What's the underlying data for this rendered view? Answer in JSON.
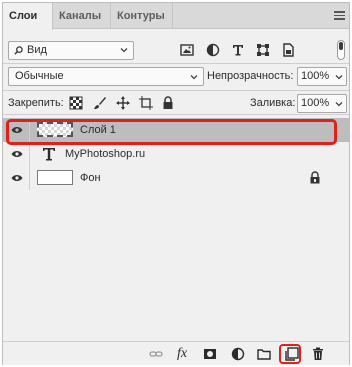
{
  "tabs": [
    {
      "label": "Слои",
      "active": true
    },
    {
      "label": "Каналы",
      "active": false
    },
    {
      "label": "Контуры",
      "active": false
    }
  ],
  "filter": {
    "kind_label": "Вид",
    "icons": [
      "pixel-filter-icon",
      "adjustment-filter-icon",
      "type-filter-icon",
      "shape-filter-icon",
      "smart-object-filter-icon"
    ]
  },
  "blend": {
    "mode": "Обычные",
    "opacity_label": "Непрозрачность:",
    "opacity_value": "100%"
  },
  "lock": {
    "label": "Закрепить:",
    "fill_label": "Заливка:",
    "fill_value": "100%"
  },
  "layers": [
    {
      "name": "Слой 1",
      "visible": true,
      "selected": true,
      "kind": "pixel"
    },
    {
      "name": "MyPhotoshop.ru",
      "visible": true,
      "selected": false,
      "kind": "text"
    },
    {
      "name": "Фон",
      "visible": true,
      "selected": false,
      "kind": "background",
      "locked": true
    }
  ],
  "colors": {
    "highlight": "#e0201a",
    "selected_row": "#bdbdbd",
    "panel_bg": "#f0f0f0"
  }
}
